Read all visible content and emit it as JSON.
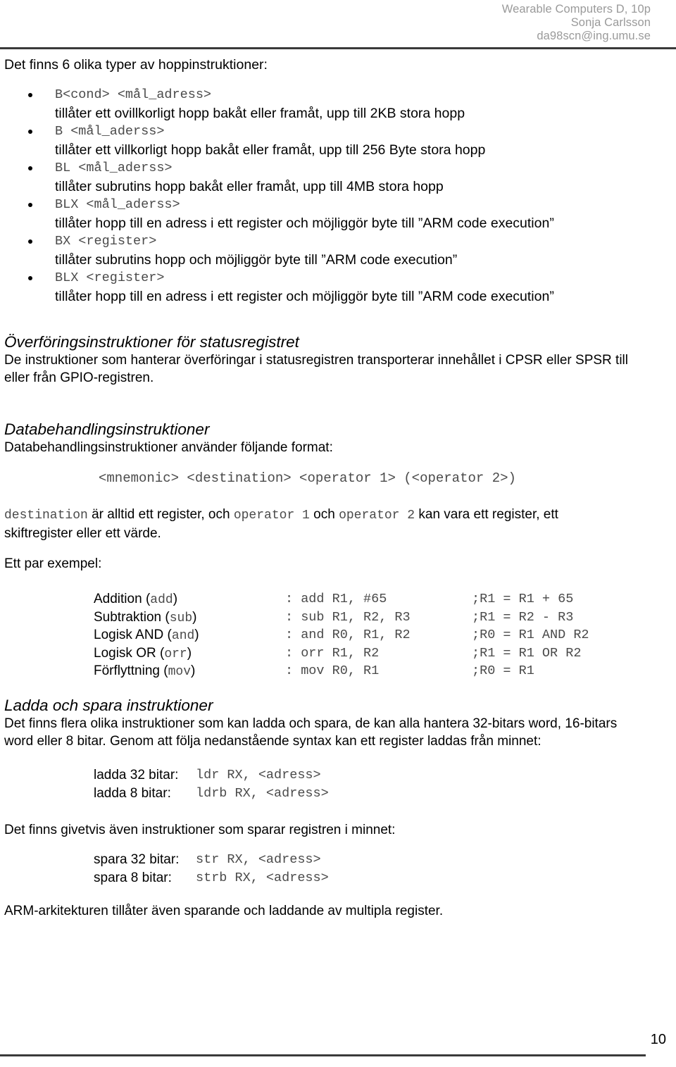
{
  "header": {
    "line1": "Wearable Computers D, 10p",
    "line2": "Sonja Carlsson",
    "line3": "da98scn@ing.umu.se"
  },
  "intro": "Det finns 6 olika typer av hoppinstruktioner:",
  "bullets": [
    {
      "code": "B<cond> <mål_adress>",
      "desc": "tillåter ett ovillkorligt hopp bakåt eller framåt, upp till 2KB stora hopp"
    },
    {
      "code": "B <mål_aderss>",
      "desc": "tillåter ett villkorligt hopp bakåt eller framåt, upp till 256 Byte stora hopp"
    },
    {
      "code": "BL <mål_aderss>",
      "desc": "tillåter subrutins hopp bakåt eller framåt, upp till 4MB stora hopp"
    },
    {
      "code": "BLX <mål_aderss>",
      "desc": "tillåter hopp till en adress i ett register och möjliggör byte till ”ARM code execution”"
    },
    {
      "code": "BX <register>",
      "desc": "tillåter subrutins hopp och möjliggör byte till ”ARM code execution”"
    },
    {
      "code": "BLX <register>",
      "desc": "tillåter hopp till en adress i ett register och möjliggör byte till ”ARM code execution”"
    }
  ],
  "transfer_section": {
    "heading": "Överföringsinstruktioner för statusregistret",
    "line1": "De instruktioner som hanterar överföringar i statusregistren transporterar innehållet i CPSR eller SPSR till",
    "line2": "eller från GPIO-registren."
  },
  "data_section": {
    "heading": "Databehandlingsinstruktioner",
    "line1": "Databehandlingsinstruktioner använder följande format:",
    "format": "<mnemonic> <destination> <operator 1> (<operator 2>)",
    "dest_para": {
      "p1_mono": "destination",
      "p2": " är alltid ett register, och ",
      "p3_mono": "operator 1",
      "p4": " och ",
      "p5_mono": "operator 2",
      "p6": " kan vara ett register, ett",
      "line2": "skiftregister eller ett värde."
    },
    "examples_label": "Ett par exempel:",
    "examples": [
      {
        "name": "Addition (add)",
        "name_plain": "Addition",
        "name_mono": "add",
        "instruction": ": add R1, #65",
        "comment": ";R1 = R1 + 65"
      },
      {
        "name": "Subtraktion (sub)",
        "name_plain": "Subtraktion",
        "name_mono": "sub",
        "instruction": ": sub R1, R2, R3",
        "comment": ";R1 = R2 - R3"
      },
      {
        "name": "Logisk AND (and)",
        "name_plain": "Logisk AND",
        "name_mono": "and",
        "instruction": ": and R0, R1, R2",
        "comment": ";R0 = R1 AND R2"
      },
      {
        "name": "Logisk OR (orr)",
        "name_plain": "Logisk OR",
        "name_mono": "orr",
        "instruction": ": orr R1, R2",
        "comment": ";R1 = R1 OR R2"
      },
      {
        "name": "Förflyttning (mov)",
        "name_plain": "Förflyttning",
        "name_mono": "mov",
        "instruction": ": mov R0, R1",
        "comment": ";R0 = R1"
      }
    ]
  },
  "load_section": {
    "heading": "Ladda och spara instruktioner",
    "line1": "Det finns flera olika instruktioner som kan ladda och spara, de kan alla hantera 32-bitars word, 16-bitars",
    "line2": "word eller 8 bitar. Genom att följa nedanstående syntax kan ett register laddas från minnet:",
    "pairs": [
      {
        "label": "ladda 32 bitar:",
        "code": "ldr RX, <adress>"
      },
      {
        "label": "ladda 8 bitar:",
        "code": "ldrb RX, <adress>"
      }
    ],
    "store_intro": "Det finns givetvis även instruktioner som sparar registren i minnet:",
    "store_pairs": [
      {
        "label": "spara 32 bitar:",
        "code": "str RX, <adress>"
      },
      {
        "label": "spara 8 bitar:",
        "code": "strb RX, <adress>"
      }
    ],
    "closing": "ARM-arkitekturen tillåter även sparande och laddande av multipla register."
  },
  "footer": {
    "page_number": "10"
  }
}
